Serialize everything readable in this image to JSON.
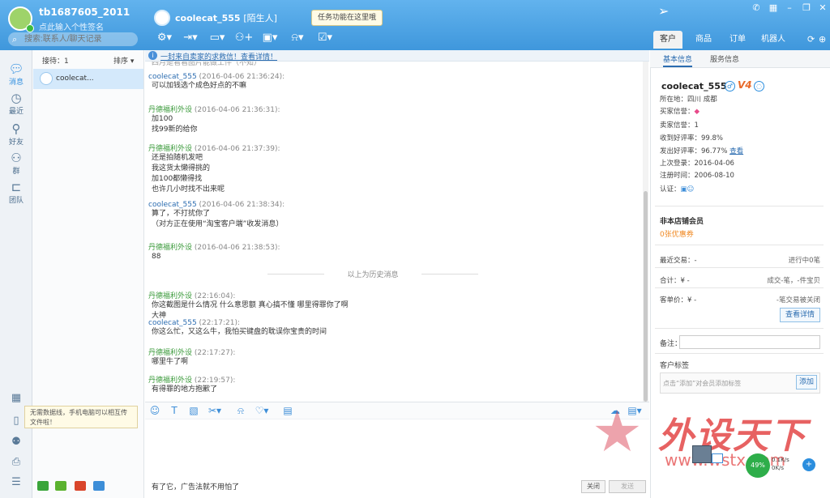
{
  "app": {
    "my_name": "tb1687605_2011",
    "my_signature": "点此输入个性签名",
    "search_placeholder": "搜索:联系人/聊天记录"
  },
  "header": {
    "contact_name": "coolecat_555",
    "contact_tag": "[陌生人]",
    "tooltip": "任务功能在这里哦"
  },
  "right_tabs": [
    "客户",
    "商品",
    "订单",
    "机器人"
  ],
  "left_rail": [
    "消息",
    "最近",
    "好友",
    "群",
    "团队"
  ],
  "conv_list": {
    "sort_label": "接待：1",
    "sort_select": "排序 ▾",
    "item": "coolecat..."
  },
  "notice": "一封来自卖家的求救信！查看详情！",
  "messages": [
    {
      "cls": "me",
      "name": "",
      "time": "",
      "lines": [
        "四月是看看图片能做工件（不知）"
      ]
    },
    {
      "cls": "me",
      "name": "coolecat_555",
      "time": "(2016-04-06 21:36:24):",
      "lines": [
        "可以加钱选个成色好点的不嘛"
      ]
    },
    {
      "cls": "other",
      "name": "丹德福利外设",
      "time": "(2016-04-06 21:36:31):",
      "lines": [
        "加100",
        "找99新的给你"
      ]
    },
    {
      "cls": "other",
      "name": "丹德福利外设",
      "time": "(2016-04-06 21:37:39):",
      "lines": [
        "还是拍随机发吧",
        "我这货太懒得挑的",
        "加100都懒得找",
        "也许几小时找不出来呢"
      ]
    },
    {
      "cls": "me",
      "name": "coolecat_555",
      "time": "(2016-04-06 21:38:34):",
      "lines": [
        "算了，不打扰你了",
        "（对方正在使用“淘宝客户端”收发消息）"
      ]
    },
    {
      "cls": "other",
      "name": "丹德福利外设",
      "time": "(2016-04-06 21:38:53):",
      "lines": [
        "88"
      ]
    },
    {
      "cls": "other",
      "name": "丹德福利外设",
      "time": "(22:16:04):",
      "lines": [
        "你这截图是什么情况 什么意思额 真心搞不懂 哪里得罪你了啊",
        "大神"
      ]
    },
    {
      "cls": "me",
      "name": "coolecat_555",
      "time": "(22:17:21):",
      "lines": [
        "你这么忙，又这么牛，我怕买键盘的耽误你宝贵的时间"
      ]
    },
    {
      "cls": "other",
      "name": "丹德福利外设",
      "time": "(22:17:27):",
      "lines": [
        "哪里牛了啊"
      ]
    },
    {
      "cls": "other",
      "name": "丹德福利外设",
      "time": "(22:19:57):",
      "lines": [
        "有得罪的地方抱歉了"
      ]
    }
  ],
  "history_divider": "以上为历史消息",
  "input": {
    "ad_text": "有了它，广告法就不用怕了",
    "close": "关闭",
    "send": "发送"
  },
  "offline_tip": "无需数据线，手机电脑可以相互传文件啦！",
  "info_tabs": [
    "基本信息",
    "服务信息"
  ],
  "customer": {
    "name": "coolecat_555",
    "vip": "V4",
    "location": "所在地：四川 成都",
    "buyer_credit": "买家信誉：",
    "seller_credit": "卖家信誉：1",
    "received_good": "收到好评率：99.8%",
    "given_good": "发出好评率：96.77%",
    "view": "查看",
    "last_login": "上次登录：2016-04-06",
    "register": "注册时间：2006-08-10",
    "verify": "认证："
  },
  "member": {
    "title": "非本店铺会员",
    "coupon": "0张优惠券"
  },
  "stats": {
    "recent_l": "最近交易：-",
    "recent_r": "进行中0笔",
    "total_l": "合计：¥ -",
    "total_r": "成交-笔，-件宝贝",
    "unit_l": "客单价：¥ -",
    "unit_r": "-笔交易被关闭",
    "detail_btn": "查看详情"
  },
  "note_label": "备注：",
  "tags": {
    "title": "客户标签",
    "hint": "点击“添加”对会员添加标签",
    "add": "添加"
  },
  "watermark": {
    "text": "外设天下",
    "url": "www.wstx.com"
  },
  "speed": {
    "pct": "49%",
    "up": "0.1K/s",
    "down": "0K/s"
  },
  "colors": {
    "top_bar": "#4aa3e6",
    "accent": "#2b6cb0",
    "other_name": "#3a9a3a"
  }
}
